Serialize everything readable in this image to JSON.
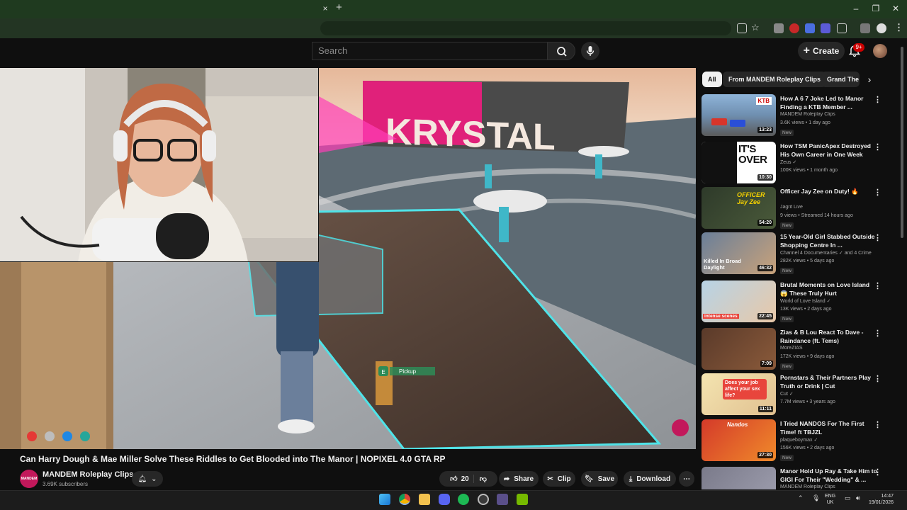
{
  "browser": {
    "tab_close": "×",
    "new_tab": "+",
    "window_minimize": "–",
    "window_maximize": "❐",
    "window_close": "✕"
  },
  "header": {
    "search_placeholder": "Search",
    "create_label": "Create",
    "notifications_count": "9+"
  },
  "video": {
    "title": "Can Harry Dough & Mae Miller Solve These Riddles to Get Blooded into The Manor | NOPIXEL 4.0 GTA RP",
    "channel_avatar_text": "MANDEM",
    "channel_name": "MANDEM Roleplay Clips",
    "subscribers": "3.69K subscribers",
    "likes": "20",
    "share_label": "Share",
    "clip_label": "Clip",
    "save_label": "Save",
    "download_label": "Download",
    "scene_sign": "KRYSTAL",
    "scene_prompt_key": "E",
    "scene_prompt_label": "Pickup"
  },
  "sidebar": {
    "chips": [
      "All",
      "From MANDEM Roleplay Clips",
      "Grand The"
    ],
    "recommendations": [
      {
        "title": "How A 6 7 Joke Led to Manor Finding a KTB Member ...",
        "channel": "MANDEM Roleplay Clips",
        "meta": "3.6K views • 1 day ago",
        "badge": "New",
        "duration": "13:23",
        "thumb_text": "KTB"
      },
      {
        "title": "How TSM PanicApex Destroyed His Own Career in One Week",
        "channel": "Zeus ✓",
        "meta": "100K views • 1 month ago",
        "badge": "",
        "duration": "10:30",
        "thumb_text": "IT'S OVER"
      },
      {
        "title": "Officer Jay Zee on Duty! 🔥",
        "channel": "Jagrit Live",
        "meta": "9 views • Streamed 14 hours ago",
        "badge": "New",
        "duration": "54:20",
        "thumb_text": "OFFICER Jay Zee"
      },
      {
        "title": "15 Year-Old Girl Stabbed Outside Shopping Centre In ...",
        "channel": "Channel 4 Documentaries ✓ and 4 Crime",
        "meta": "282K views • 5 days ago",
        "badge": "New",
        "duration": "46:32",
        "thumb_text": "Killed In Broad Daylight"
      },
      {
        "title": "Brutal Moments on Love Island 😱 These Truly Hurt",
        "channel": "World of Love Island ✓",
        "meta": "13K views • 2 days ago",
        "badge": "New",
        "duration": "22:45",
        "thumb_text": "intense scenes"
      },
      {
        "title": "Zias & B Lou React To Dave - Raindance (ft. Tems)",
        "channel": "MoreZIAS",
        "meta": "172K views • 9 days ago",
        "badge": "New",
        "duration": "7:09",
        "thumb_text": ""
      },
      {
        "title": "Pornstars & Their Partners Play Truth or Drink | Cut",
        "channel": "Cut ✓",
        "meta": "7.7M views • 3 years ago",
        "badge": "",
        "duration": "11:11",
        "thumb_text": "Does your job affect your sex life?"
      },
      {
        "title": "I Tried NANDOS For The First Time! ft TBJZL",
        "channel": "plaqueboymax ✓",
        "meta": "156K views • 2 days ago",
        "badge": "New",
        "duration": "27:30",
        "thumb_text": "Nandos"
      },
      {
        "title": "Manor Hold Up Ray & Take Him to GIGI For Their \"Wedding\" & ...",
        "channel": "MANDEM Roleplay Clips",
        "meta": "",
        "badge": "",
        "duration": "",
        "thumb_text": ""
      }
    ]
  },
  "taskbar": {
    "lang_line1": "ENG",
    "lang_line2": "UK",
    "time": "14:47",
    "date": "19/01/2026"
  },
  "colors": {
    "background": "#0f0f0f",
    "accent_red": "#cc0000",
    "chrome_green": "#1f3a1f",
    "hologram_cyan": "#4fe3e8",
    "sign_pink": "#e0217a"
  }
}
